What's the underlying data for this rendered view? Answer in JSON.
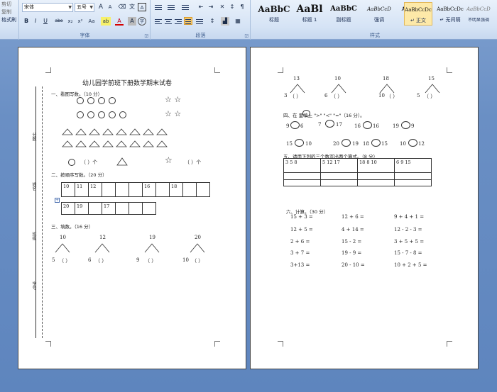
{
  "clipboard": {
    "items": [
      "剪切",
      "复制",
      "格式刷"
    ]
  },
  "font": {
    "name": "宋体",
    "size": "五号",
    "group_label": "字体",
    "grow": "A",
    "shrink": "A",
    "clear": "A",
    "bold": "B",
    "italic": "I",
    "underline": "U",
    "strike": "abe",
    "sub": "x₂",
    "sup": "x²",
    "case": "Aa",
    "highlight": "ab",
    "color": "A",
    "char_shade": "A"
  },
  "paragraph": {
    "group_label": "段落"
  },
  "styles": {
    "group_label": "样式",
    "tiles": [
      {
        "preview": "AaBbC",
        "name": "标题"
      },
      {
        "preview": "AaBl",
        "name": "标题 1"
      },
      {
        "preview": "AaBbC",
        "name": "副标题"
      },
      {
        "preview": "AaBbCcD",
        "name": "强调"
      },
      {
        "preview": "AaBbCcD",
        "name": "要点"
      },
      {
        "preview": "AaBbCcDc",
        "name": "↵ 正文"
      },
      {
        "preview": "AaBbCcDc",
        "name": "↵ 无间隔"
      },
      {
        "preview": "AaBbCcDc",
        "name": "不明显强调"
      }
    ]
  },
  "page1": {
    "title": "幼儿园学前班下册数学期末试卷",
    "sec1": "一、看图写数。（10 分）",
    "sec2": "二、按顺序写数。（20 分）",
    "sec3": "三、填数。（16 分）",
    "row1_cells": [
      "10",
      "11",
      "12",
      "",
      "",
      "",
      "16",
      "",
      "18",
      "",
      ""
    ],
    "row2_cells": [
      "20",
      "19",
      "",
      "17",
      "",
      "",
      ""
    ],
    "paren_ge": "（    ）个",
    "tree_tops": [
      "10",
      "12",
      "19",
      "20"
    ],
    "tree_left": [
      "5",
      "6",
      "9",
      "10"
    ],
    "paren": "（   ）",
    "side": [
      "姓名",
      "班级",
      "学号",
      "分数"
    ]
  },
  "page2": {
    "tree_tops": [
      "13",
      "10",
      "18",
      "15"
    ],
    "tree_left": [
      "3",
      "6",
      "10",
      "5"
    ],
    "paren": "（   ）",
    "sec4": "四、在     里填上  \">\"  \"<\"  \"=\"（16 分）。",
    "cmp_row1": [
      [
        "9",
        "6"
      ],
      [
        "7",
        "17"
      ],
      [
        "16",
        "16"
      ],
      [
        "19",
        "9"
      ]
    ],
    "cmp_row2": [
      [
        "15",
        "10"
      ],
      [
        "20",
        "19"
      ],
      [
        "18",
        "15"
      ],
      [
        "10",
        "12"
      ]
    ],
    "sec5": "五、请用下列的三个数写出两个算式。（8 分）",
    "triples": [
      "3    5    8",
      "5   12   17",
      "18   8   10",
      "6    9   15"
    ],
    "sec6": "六、计算。（30 分）",
    "calc": [
      [
        "15 + 3 =",
        "12 + 6 =",
        "9 + 4 + 1 ="
      ],
      [
        "12 + 5 =",
        "4 + 14 =",
        "12 - 2 - 3 ="
      ],
      [
        "2 + 6 =",
        "15 - 2 =",
        "3 + 5 + 5 ="
      ],
      [
        "3 + 7 =",
        "19 - 9 =",
        "15 - 7 - 8 ="
      ],
      [
        "3+13 =",
        "20 - 10 =",
        "10 + 2 + 5 ="
      ]
    ]
  }
}
